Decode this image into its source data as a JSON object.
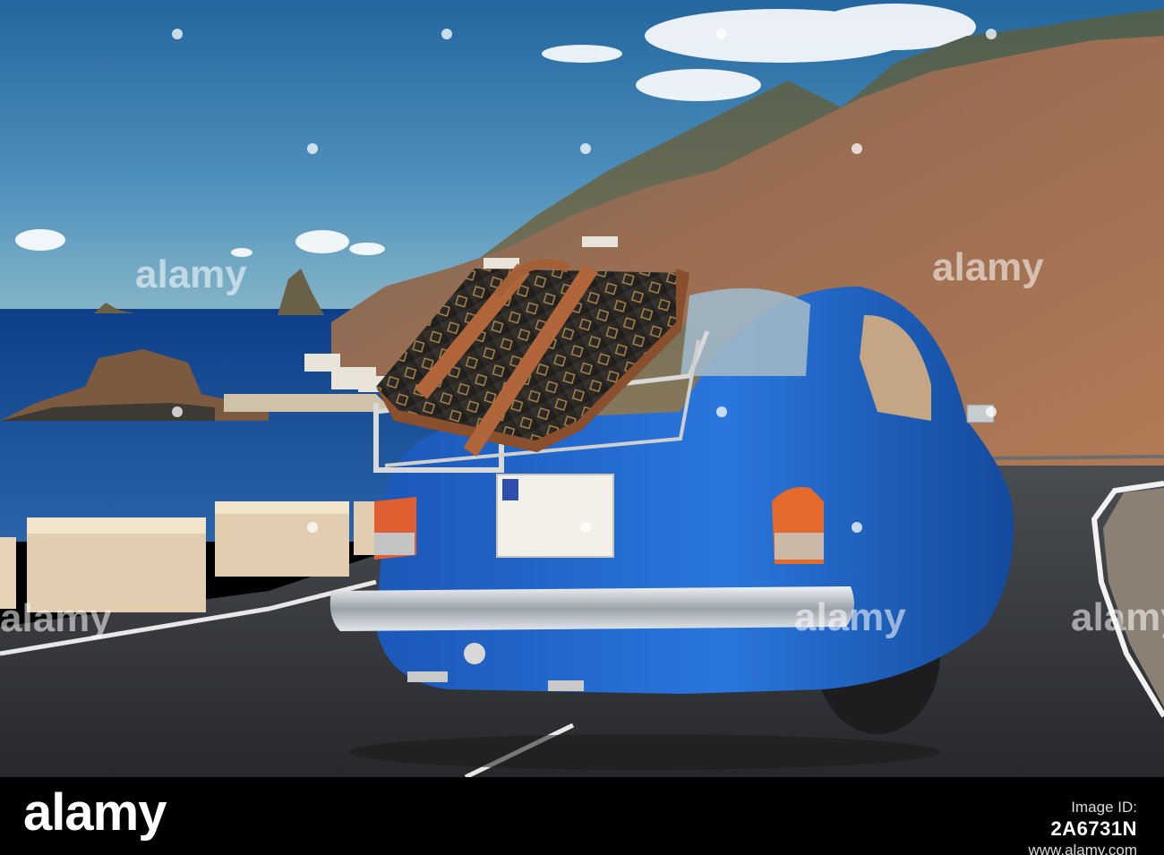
{
  "watermark": {
    "brand": "alamy",
    "tile_text": "alamy",
    "tile_color": "#ffffff"
  },
  "footer": {
    "image_id_label": "Image ID:",
    "image_id": "2A6731N",
    "url": "www.alamy.com"
  },
  "scene": {
    "sky_color": "#3d7fb3",
    "sea_color": "#12438a",
    "car_color": "#1d62c6",
    "road_color": "#3b3d42"
  }
}
